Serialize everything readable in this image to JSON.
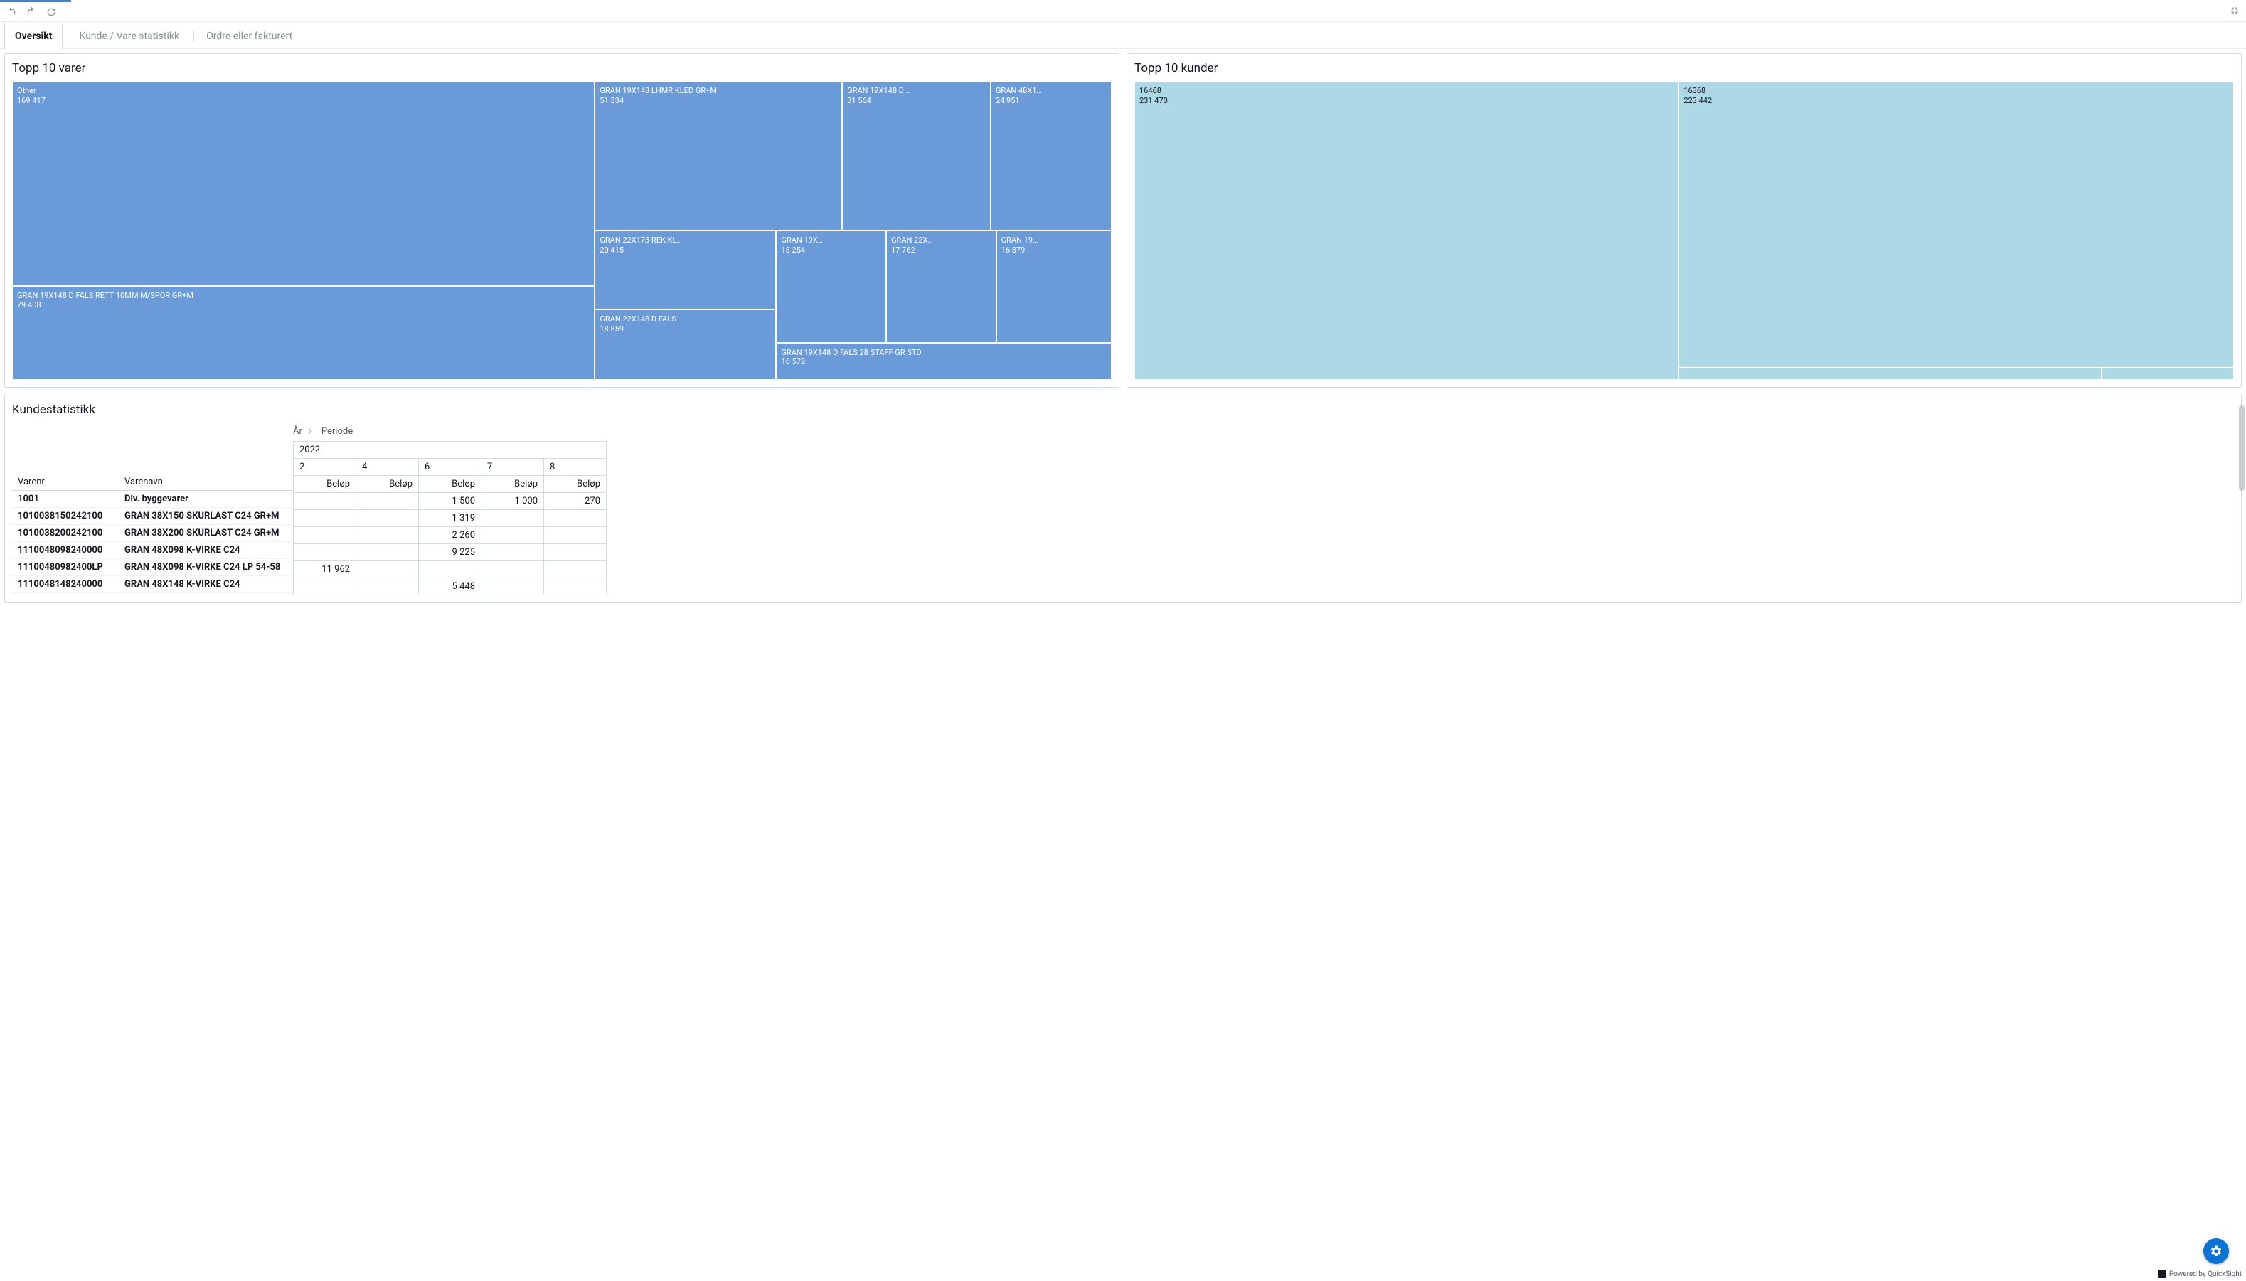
{
  "tabs": {
    "t1": "Oversikt",
    "t2": "Kunde / Vare statistikk",
    "t3": "Ordre eller fakturert"
  },
  "panel_varer": {
    "title": "Topp 10 varer"
  },
  "panel_kunder": {
    "title": "Topp 10 kunder"
  },
  "panel_table": {
    "title": "Kundestatistikk"
  },
  "crumb": {
    "year": "År",
    "period": "Periode"
  },
  "tm1": {
    "other_l": "Other",
    "other_v": "169 417",
    "c2_l": "GRAN 19X148 D FALS RETT 10MM M/SPOR GR+M",
    "c2_v": "79 408",
    "c3_l": "GRAN 19X148 LHMR KLED GR+M",
    "c3_v": "51 334",
    "c4_l": "GRAN 22X173 REK KL…",
    "c4_v": "20 415",
    "c5_l": "GRAN 22X148 D FALS …",
    "c5_v": "18 859",
    "c6_l": "GRAN 19X148 D …",
    "c6_v": "31 564",
    "c7_l": "GRAN 48X1…",
    "c7_v": "24 951",
    "c8_l": "GRAN 19X…",
    "c8_v": "18 254",
    "c9_l": "GRAN 22X…",
    "c9_v": "17 762",
    "c10_l": "GRAN 19…",
    "c10_v": "16 879",
    "c11_l": "GRAN 19X148 D FALS 28 STAFF GR STD",
    "c11_v": "16 572"
  },
  "tm2": {
    "c1_l": "16468",
    "c1_v": "231 470",
    "c2_l": "16368",
    "c2_v": "223 442"
  },
  "table": {
    "year": "2022",
    "cols": {
      "c1": "2",
      "c2": "4",
      "c3": "6",
      "c4": "7",
      "c5": "8"
    },
    "h_varenr": "Varenr",
    "h_varenavn": "Varenavn",
    "h_belop": "Beløp",
    "rows": [
      {
        "nr": "1001",
        "navn": "Div. byggevarer",
        "v": [
          "",
          "",
          "1 500",
          "1 000",
          "270"
        ]
      },
      {
        "nr": "1010038150242100",
        "navn": "GRAN 38X150 SKURLAST C24 GR+M",
        "v": [
          "",
          "",
          "1 319",
          "",
          ""
        ]
      },
      {
        "nr": "1010038200242100",
        "navn": "GRAN 38X200 SKURLAST C24 GR+M",
        "v": [
          "",
          "",
          "2 260",
          "",
          ""
        ]
      },
      {
        "nr": "1110048098240000",
        "navn": "GRAN 48X098 K-VIRKE C24",
        "v": [
          "",
          "",
          "9 225",
          "",
          ""
        ]
      },
      {
        "nr": "11100480982400LP",
        "navn": "GRAN 48X098 K-VIRKE C24 LP 54-58",
        "v": [
          "11 962",
          "",
          "",
          "",
          ""
        ]
      },
      {
        "nr": "1110048148240000",
        "navn": "GRAN 48X148 K-VIRKE C24",
        "v": [
          "",
          "",
          "5 448",
          "",
          ""
        ]
      }
    ]
  },
  "footer": {
    "powered": "Powered by QuickSight"
  },
  "chart_data": [
    {
      "type": "treemap",
      "title": "Topp 10 varer",
      "items": [
        {
          "label": "Other",
          "value": 169417
        },
        {
          "label": "GRAN 19X148 D FALS RETT 10MM M/SPOR GR+M",
          "value": 79408
        },
        {
          "label": "GRAN 19X148 LHMR KLED GR+M",
          "value": 51334
        },
        {
          "label": "GRAN 19X148 D …",
          "value": 31564
        },
        {
          "label": "GRAN 48X1…",
          "value": 24951
        },
        {
          "label": "GRAN 22X173 REK KL…",
          "value": 20415
        },
        {
          "label": "GRAN 22X148 D FALS …",
          "value": 18859
        },
        {
          "label": "GRAN 19X…",
          "value": 18254
        },
        {
          "label": "GRAN 22X…",
          "value": 17762
        },
        {
          "label": "GRAN 19…",
          "value": 16879
        },
        {
          "label": "GRAN 19X148 D FALS 28 STAFF GR STD",
          "value": 16572
        }
      ]
    },
    {
      "type": "treemap",
      "title": "Topp 10 kunder",
      "items": [
        {
          "label": "16468",
          "value": 231470
        },
        {
          "label": "16368",
          "value": 223442
        }
      ]
    },
    {
      "type": "table",
      "title": "Kundestatistikk",
      "columns": [
        "Varenr",
        "Varenavn",
        "2022/2 Beløp",
        "2022/4 Beløp",
        "2022/6 Beløp",
        "2022/7 Beløp",
        "2022/8 Beløp"
      ],
      "rows": [
        [
          "1001",
          "Div. byggevarer",
          null,
          null,
          1500,
          1000,
          270
        ],
        [
          "1010038150242100",
          "GRAN 38X150 SKURLAST C24 GR+M",
          null,
          null,
          1319,
          null,
          null
        ],
        [
          "1010038200242100",
          "GRAN 38X200 SKURLAST C24 GR+M",
          null,
          null,
          2260,
          null,
          null
        ],
        [
          "1110048098240000",
          "GRAN 48X098 K-VIRKE C24",
          null,
          null,
          9225,
          null,
          null
        ],
        [
          "11100480982400LP",
          "GRAN 48X098 K-VIRKE C24 LP 54-58",
          11962,
          null,
          null,
          null,
          null
        ],
        [
          "1110048148240000",
          "GRAN 48X148 K-VIRKE C24",
          null,
          null,
          5448,
          null,
          null
        ]
      ]
    }
  ]
}
